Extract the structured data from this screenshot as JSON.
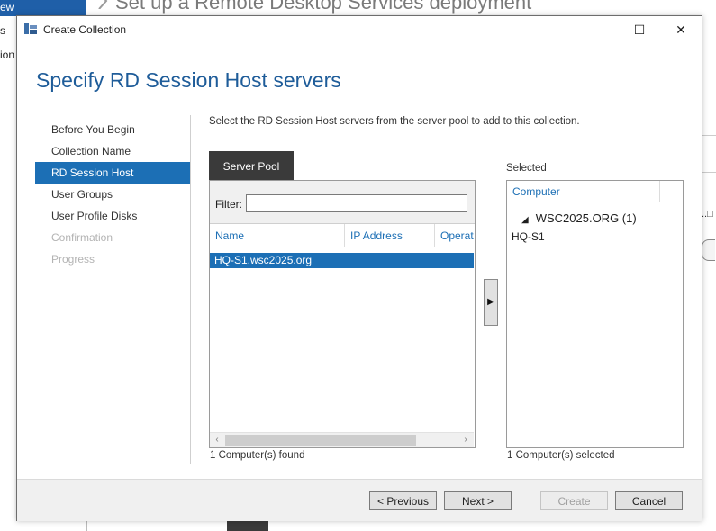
{
  "background": {
    "nav_label": "ew",
    "letters": [
      "s",
      "ion"
    ],
    "title": "Set up a Remote Desktop Services deployment"
  },
  "dialog": {
    "title": "Create Collection",
    "heading": "Specify RD Session Host servers",
    "nav": [
      {
        "label": "Before You Begin",
        "state": "normal"
      },
      {
        "label": "Collection Name",
        "state": "normal"
      },
      {
        "label": "RD Session Host",
        "state": "active"
      },
      {
        "label": "User Groups",
        "state": "normal"
      },
      {
        "label": "User Profile Disks",
        "state": "normal"
      },
      {
        "label": "Confirmation",
        "state": "disabled"
      },
      {
        "label": "Progress",
        "state": "disabled"
      }
    ],
    "instruction": "Select the RD Session Host servers from the server pool to add to this collection.",
    "server_pool": {
      "tab_label": "Server Pool",
      "filter_label": "Filter:",
      "filter_value": "",
      "columns": [
        "Name",
        "IP Address",
        "Operat"
      ],
      "rows": [
        {
          "name": "HQ-S1.wsc2025.org"
        }
      ],
      "found_text": "1 Computer(s) found"
    },
    "add_button_glyph": "▶",
    "selected": {
      "label": "Selected",
      "column": "Computer",
      "group": "WSC2025.ORG (1)",
      "items": [
        "HQ-S1"
      ],
      "count_text": "1 Computer(s) selected"
    },
    "buttons": {
      "previous": "< Previous",
      "next": "Next >",
      "create": "Create",
      "cancel": "Cancel"
    }
  },
  "colors": {
    "accent": "#1c6fb5",
    "heading": "#1e5c99",
    "tab_dark": "#3a3a3a"
  }
}
